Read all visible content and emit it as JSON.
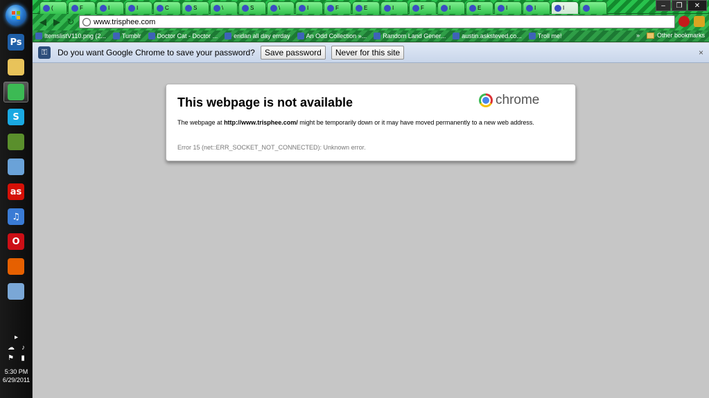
{
  "taskbar": {
    "pinned": [
      {
        "name": "photoshop-icon",
        "glyph": "Ps",
        "color": "#1f5fa8"
      },
      {
        "name": "explorer-icon",
        "glyph": "",
        "color": "#e8c35a"
      },
      {
        "name": "chrome-icon",
        "glyph": "",
        "color": "#3cba54",
        "active": true
      },
      {
        "name": "skype-icon",
        "glyph": "S",
        "color": "#1aa9e2"
      },
      {
        "name": "minecraft-icon",
        "glyph": "",
        "color": "#5a8f2c"
      },
      {
        "name": "notepad-icon",
        "glyph": "",
        "color": "#6aa2d8"
      },
      {
        "name": "lastfm-icon",
        "glyph": "as",
        "color": "#d51007"
      },
      {
        "name": "itunes-icon",
        "glyph": "♫",
        "color": "#3a7bd5"
      },
      {
        "name": "opera-icon",
        "glyph": "O",
        "color": "#cc0f16"
      },
      {
        "name": "firefox-icon",
        "glyph": "",
        "color": "#e66000"
      },
      {
        "name": "paint-icon",
        "glyph": "",
        "color": "#7aa7d6"
      }
    ],
    "clock": {
      "time": "5:30 PM",
      "date": "6/29/2011"
    }
  },
  "browser": {
    "address": "www.trisphee.com",
    "tabs": [
      {
        "label": "(",
        "selected": false
      },
      {
        "label": "F",
        "selected": false
      },
      {
        "label": "I",
        "selected": false
      },
      {
        "label": "I",
        "selected": false
      },
      {
        "label": "C",
        "selected": false
      },
      {
        "label": "S",
        "selected": false
      },
      {
        "label": "\\",
        "selected": false
      },
      {
        "label": "S",
        "selected": false
      },
      {
        "label": "\\",
        "selected": false
      },
      {
        "label": "I",
        "selected": false
      },
      {
        "label": "F",
        "selected": false
      },
      {
        "label": "E",
        "selected": false
      },
      {
        "label": "I",
        "selected": false
      },
      {
        "label": "F",
        "selected": false
      },
      {
        "label": "I",
        "selected": false
      },
      {
        "label": "E",
        "selected": false
      },
      {
        "label": "I",
        "selected": false
      },
      {
        "label": "I",
        "selected": false
      },
      {
        "label": "I",
        "selected": true
      },
      {
        "label": "",
        "selected": false
      }
    ],
    "bookmarks": [
      "ItemslistV110.png (2...",
      "Tumblr",
      "Doctor Cat - Doctor ...",
      "eridan all day errday",
      "An Odd Collection »...",
      "Random Land Gener...",
      "austin.asksteved.co...",
      "Troll me!"
    ],
    "bookmarks_overflow": "»",
    "other_bookmarks": "Other bookmarks"
  },
  "infobar": {
    "message": "Do you want Google Chrome to save your password?",
    "save_label": "Save password",
    "never_label": "Never for this site",
    "close": "×"
  },
  "error": {
    "title": "This webpage is not available",
    "logo_text": "chrome",
    "desc_prefix": "The webpage at ",
    "desc_url": "http://www.trisphee.com/",
    "desc_suffix": " might be temporarily down or it may have moved permanently to a new web address.",
    "code": "Error 15 (net::ERR_SOCKET_NOT_CONNECTED): Unknown error."
  },
  "colors": {
    "tab_green": "#27c24c",
    "content_bg": "#c6c6c6"
  }
}
